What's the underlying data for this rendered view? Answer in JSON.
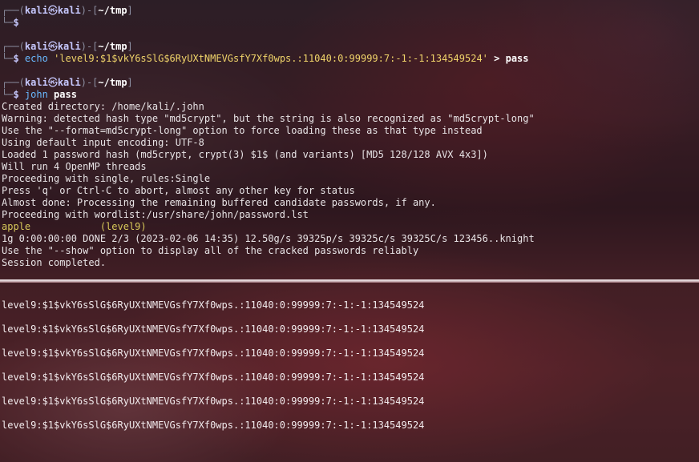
{
  "prompts": [
    {
      "user": "kali",
      "sep": "㉿",
      "host": "kali",
      "dir": "~/tmp",
      "cmd": "",
      "rest": ""
    },
    {
      "user": "kali",
      "sep": "㉿",
      "host": "kali",
      "dir": "~/tmp",
      "cmd": "echo",
      "str": "'level9:$1$vkY6sSlG$6RyUXtNMEVGsfY7Xf0wps.:11040:0:99999:7:-1:-1:134549524'",
      "rest": " > pass"
    },
    {
      "user": "kali",
      "sep": "㉿",
      "host": "kali",
      "dir": "~/tmp",
      "cmd": "john",
      "rest": " pass"
    }
  ],
  "prompt_frame": {
    "top_open": "┌──(",
    "top_mid": ")-[",
    "top_close": "]",
    "bottom": "└─",
    "dollar": "$"
  },
  "output_lines": [
    "Created directory: /home/kali/.john",
    "Warning: detected hash type \"md5crypt\", but the string is also recognized as \"md5crypt-long\"",
    "Use the \"--format=md5crypt-long\" option to force loading these as that type instead",
    "Using default input encoding: UTF-8",
    "Loaded 1 password hash (md5crypt, crypt(3) $1$ (and variants) [MD5 128/128 AVX 4x3])",
    "Will run 4 OpenMP threads",
    "Proceeding with single, rules:Single",
    "Press 'q' or Ctrl-C to abort, almost any other key for status",
    "Almost done: Processing the remaining buffered candidate passwords, if any.",
    "Proceeding with wordlist:/usr/share/john/password.lst"
  ],
  "found": {
    "password": "apple",
    "spacer": "            ",
    "user": "(level9)"
  },
  "after_lines": [
    "1g 0:00:00:00 DONE 2/3 (2023-02-06 14:35) 12.50g/s 39325p/s 39325c/s 39325C/s 123456..knight",
    "Use the \"--show\" option to display all of the cracked passwords reliably",
    "Session completed."
  ],
  "bottom_lines": [
    "level9:$1$vkY6sSlG$6RyUXtNMEVGsfY7Xf0wps.:11040:0:99999:7:-1:-1:134549524",
    "level9:$1$vkY6sSlG$6RyUXtNMEVGsfY7Xf0wps.:11040:0:99999:7:-1:-1:134549524",
    "level9:$1$vkY6sSlG$6RyUXtNMEVGsfY7Xf0wps.:11040:0:99999:7:-1:-1:134549524",
    "level9:$1$vkY6sSlG$6RyUXtNMEVGsfY7Xf0wps.:11040:0:99999:7:-1:-1:134549524",
    "level9:$1$vkY6sSlG$6RyUXtNMEVGsfY7Xf0wps.:11040:0:99999:7:-1:-1:134549524",
    "level9:$1$vkY6sSlG$6RyUXtNMEVGsfY7Xf0wps.:11040:0:99999:7:-1:-1:134549524"
  ],
  "colors": {
    "prompt_user": "#c7c9ff",
    "command": "#69b9ff",
    "string_literal": "#f0d46a",
    "cracked": "#d8c95a"
  }
}
